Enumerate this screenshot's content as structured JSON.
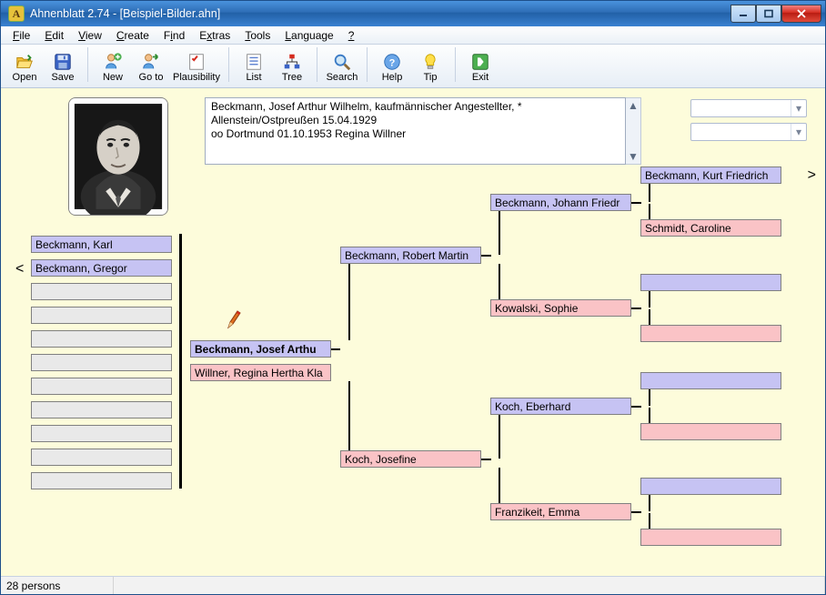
{
  "window": {
    "title": "Ahnenblatt 2.74 - [Beispiel-Bilder.ahn]"
  },
  "menu": {
    "file": "File",
    "edit": "Edit",
    "view": "View",
    "create": "Create",
    "find": "Find",
    "extras": "Extras",
    "tools": "Tools",
    "language": "Language",
    "help": "?"
  },
  "toolbar": {
    "open": "Open",
    "save": "Save",
    "new": "New",
    "goto": "Go to",
    "plausibility": "Plausibility",
    "list": "List",
    "tree": "Tree",
    "search": "Search",
    "help_btn": "Help",
    "tip": "Tip",
    "exit": "Exit"
  },
  "detail": {
    "line1": "Beckmann, Josef Arthur Wilhelm, kaufmännischer Angestellter, *",
    "line2": "Allenstein/Ostpreußen 15.04.1929",
    "line3": "oo Dortmund 01.10.1953 Regina Willner"
  },
  "sidebar": {
    "items": [
      {
        "label": "Beckmann, Karl",
        "gender": "male"
      },
      {
        "label": "Beckmann, Gregor",
        "gender": "male"
      }
    ]
  },
  "tree": {
    "focus_person": "Beckmann, Josef Arthu",
    "focus_spouse": "Willner, Regina Hertha Kla",
    "gen2_father": "Beckmann, Robert Martin",
    "gen2_mother": "Koch, Josefine",
    "gen3_pp": "Beckmann, Johann Friedr",
    "gen3_pm": "Kowalski, Sophie",
    "gen3_mp": "Koch, Eberhard",
    "gen3_mm": "Franzikeit, Emma",
    "gen4_top_p": "Beckmann, Kurt Friedrich",
    "gen4_top_m": "Schmidt, Caroline"
  },
  "status": {
    "persons": "28 persons"
  },
  "colors": {
    "male": "#c6c3f3",
    "female": "#fac3c6",
    "workspace": "#fdfcdb"
  }
}
